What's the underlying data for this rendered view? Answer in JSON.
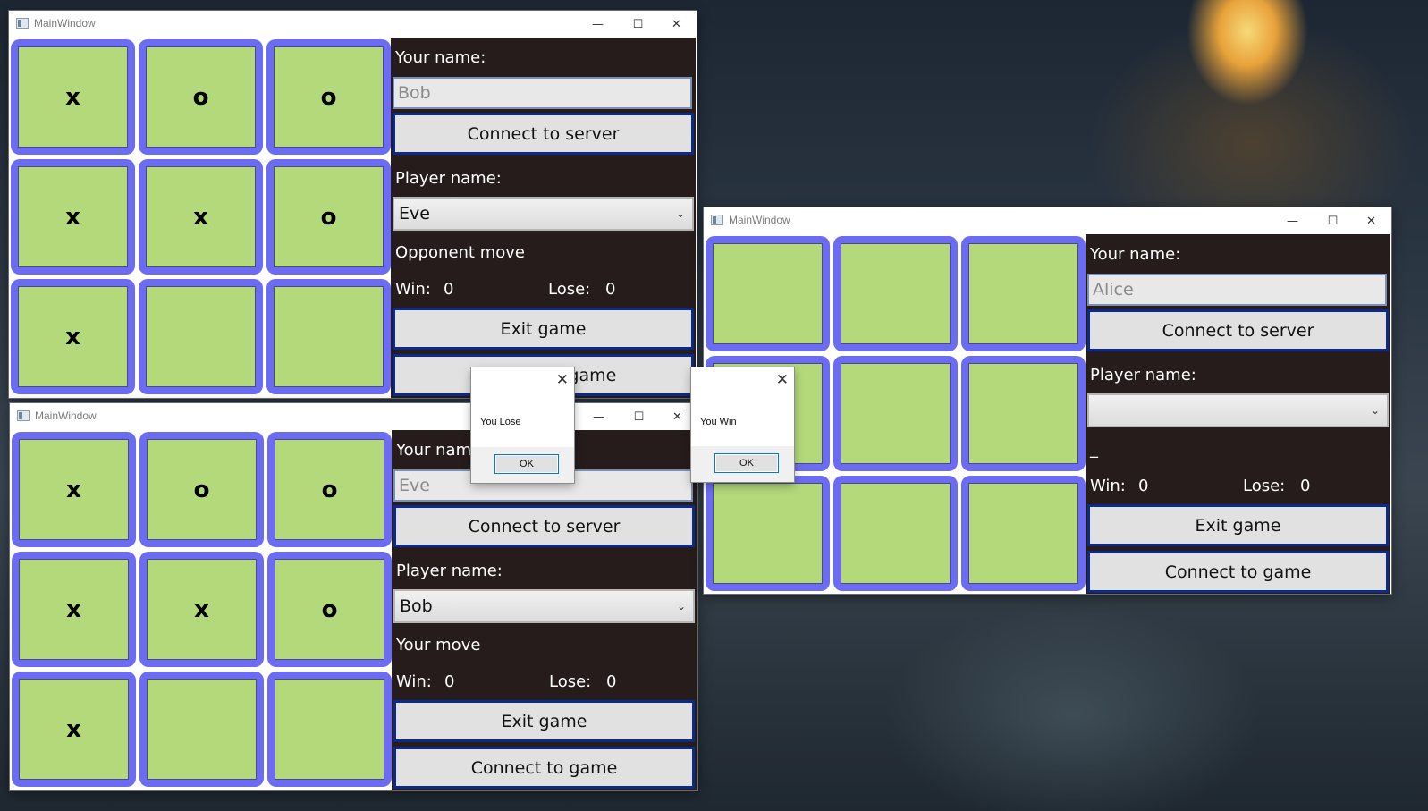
{
  "windows": [
    {
      "title": "MainWindow",
      "board": [
        "x",
        "o",
        "o",
        "x",
        "x",
        "o",
        "x",
        "",
        ""
      ],
      "your_name_label": "Your name:",
      "your_name_value": "Bob",
      "connect_server_label": "Connect to server",
      "player_name_label": "Player name:",
      "player_name_selected": "Eve",
      "status": "Opponent move",
      "win_label": "Win:",
      "win_value": "0",
      "lose_label": "Lose:",
      "lose_value": "0",
      "exit_label": "Exit game",
      "connect_game_label": "Connect to game"
    },
    {
      "title": "MainWindow",
      "board": [
        "x",
        "o",
        "o",
        "x",
        "x",
        "o",
        "x",
        "",
        ""
      ],
      "your_name_label": "Your name:",
      "your_name_value": "Eve",
      "connect_server_label": "Connect to server",
      "player_name_label": "Player name:",
      "player_name_selected": "Bob",
      "status": "Your move",
      "win_label": "Win:",
      "win_value": "0",
      "lose_label": "Lose:",
      "lose_value": "0",
      "exit_label": "Exit game",
      "connect_game_label": "Connect to game"
    },
    {
      "title": "MainWindow",
      "board": [
        "",
        "",
        "",
        "",
        "",
        "",
        "",
        "",
        ""
      ],
      "your_name_label": "Your name:",
      "your_name_value": "Alice",
      "connect_server_label": "Connect to server",
      "player_name_label": "Player name:",
      "player_name_selected": "",
      "status": "_",
      "win_label": "Win:",
      "win_value": "0",
      "lose_label": "Lose:",
      "lose_value": "0",
      "exit_label": "Exit game",
      "connect_game_label": "Connect to game"
    }
  ],
  "dialogs": [
    {
      "message": "You Lose",
      "ok_label": "OK"
    },
    {
      "message": "You Win",
      "ok_label": "OK"
    }
  ],
  "titlebar_controls": {
    "minimize": "—",
    "maximize": "☐",
    "close": "✕"
  },
  "icons": {
    "dropdown": "chevron-down-icon",
    "app": "app-window-icon"
  },
  "colors": {
    "cell_border": "#6c6cf2",
    "cell_fill": "#b3d97a",
    "panel_bg": "#261c1c",
    "button_border": "#0c2a8a"
  }
}
